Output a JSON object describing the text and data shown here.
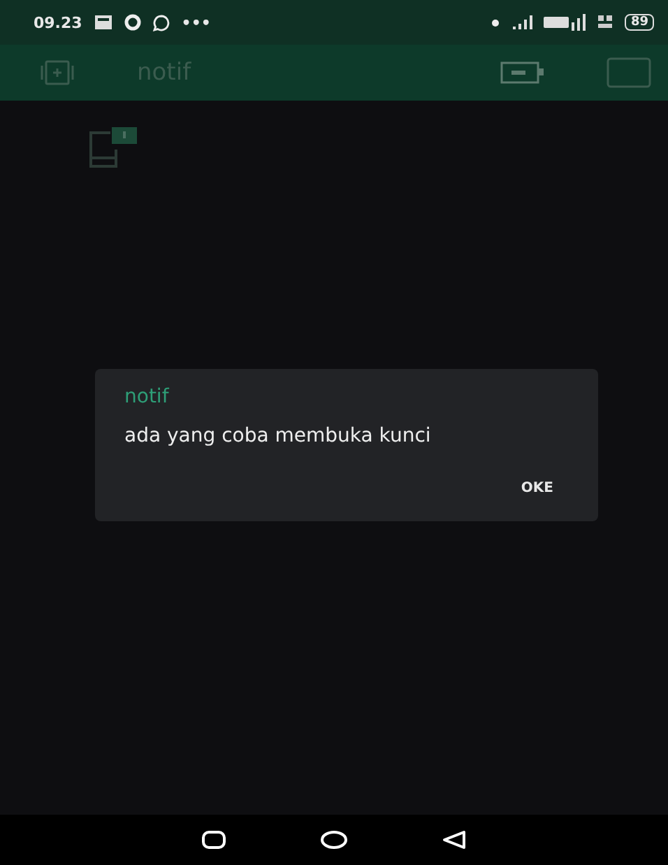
{
  "status_bar": {
    "time": "09.23",
    "more": "•••",
    "battery": "89"
  },
  "app_bar": {
    "title": "notif"
  },
  "dialog": {
    "title": "notif",
    "message": "ada yang coba membuka kunci",
    "buttons": [
      "OKE"
    ]
  }
}
